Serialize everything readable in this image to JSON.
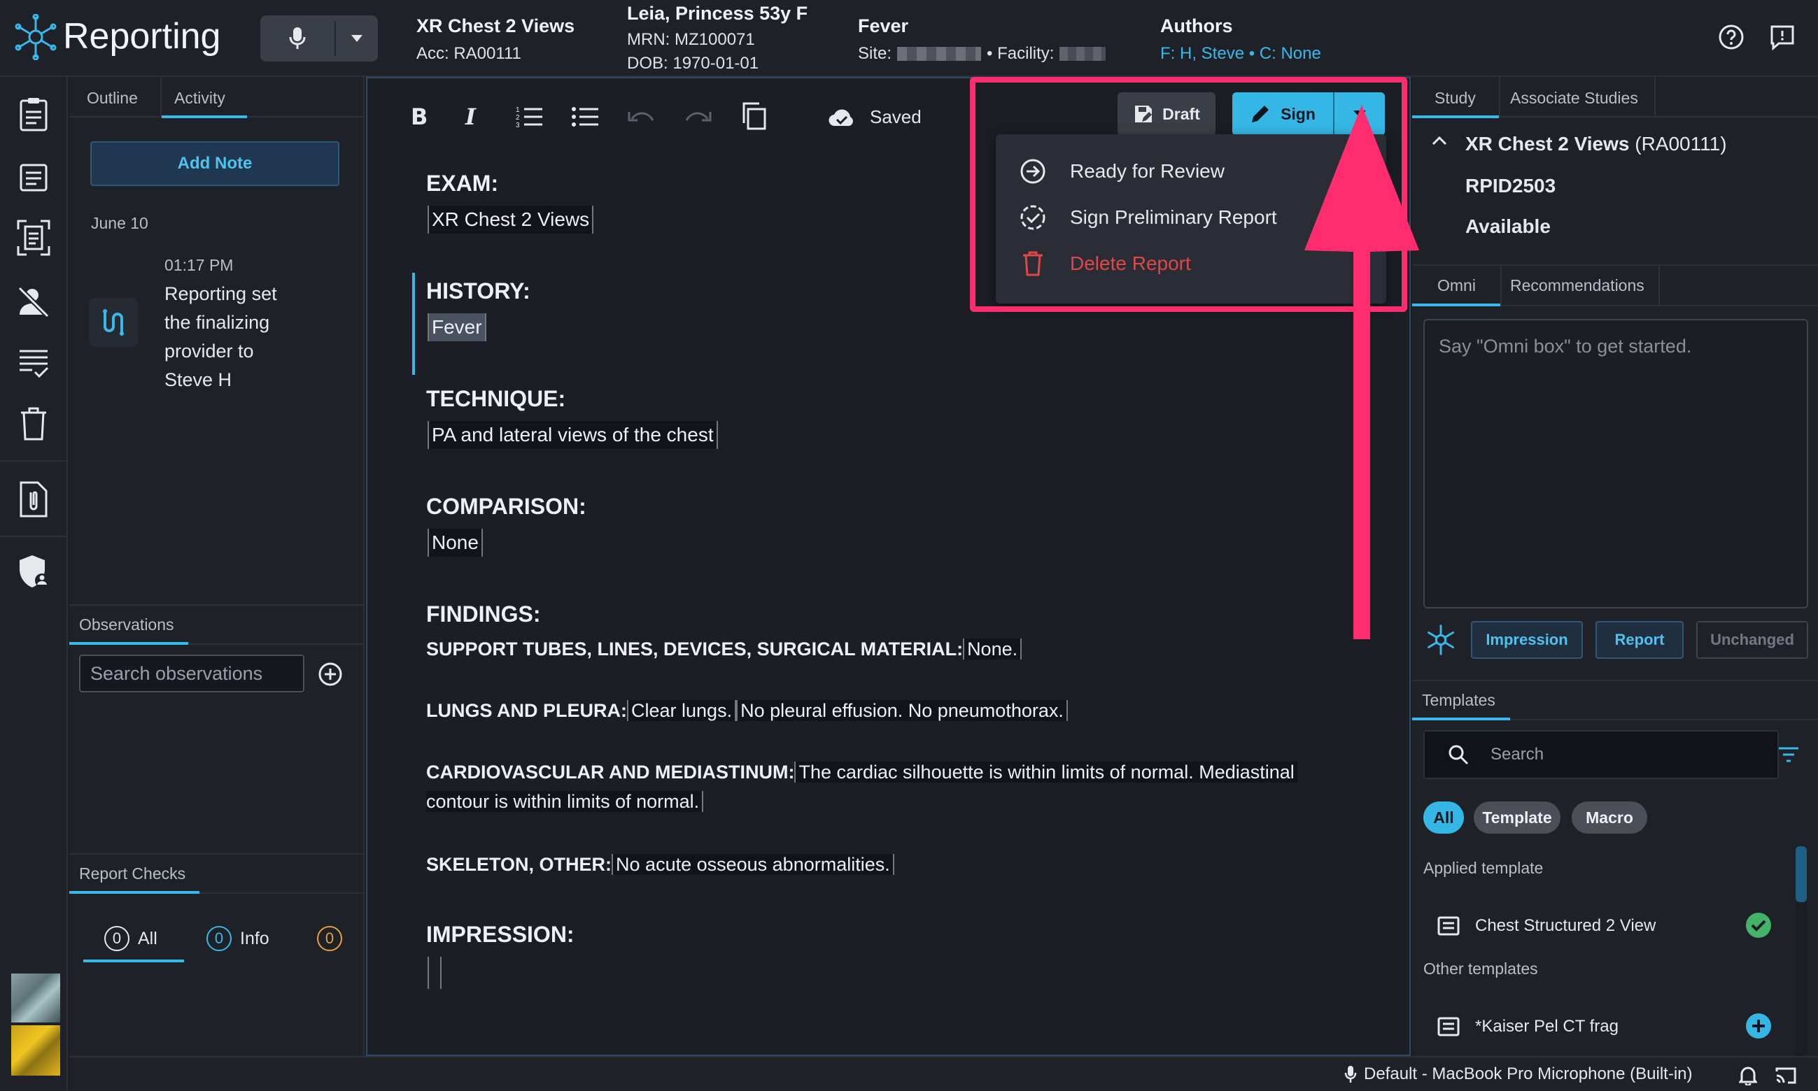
{
  "app": {
    "title": "Reporting"
  },
  "header": {
    "study_title": "XR Chest 2 Views",
    "study_acc": "Acc: RA00111",
    "patient_name": "Leia, Princess 53y F",
    "patient_mrn": "MRN: MZ100071",
    "patient_dob": "DOB: 1970-01-01",
    "reason": "Fever",
    "site_label": "Site:",
    "facility_label": "• Facility:",
    "authors_label": "Authors",
    "authors_value": "F: H, Steve • C: None"
  },
  "notes": {
    "tabs": [
      "Outline",
      "Activity"
    ],
    "add_note": "Add Note",
    "date": "June 10",
    "entry_time": "01:17 PM",
    "entry_lines": [
      "Reporting set",
      "the finalizing",
      "provider to",
      "Steve H"
    ],
    "observations_tab": "Observations",
    "search_placeholder": "Search observations",
    "report_checks_tab": "Report Checks",
    "checks": [
      {
        "count": "0",
        "label": "All"
      },
      {
        "count": "0",
        "label": "Info"
      },
      {
        "count": "0",
        "label": ""
      }
    ]
  },
  "toolbar": {
    "saved": "Saved",
    "draft": "Draft",
    "sign": "Sign"
  },
  "dropdown": {
    "ready": "Ready for Review",
    "prelim": "Sign Preliminary Report",
    "delete": "Delete Report"
  },
  "report": {
    "exam_h": "EXAM:",
    "exam_v": "XR Chest 2 Views",
    "history_h": "HISTORY:",
    "history_v": "Fever",
    "technique_h": "TECHNIQUE:",
    "technique_v": "PA and lateral views of the chest",
    "comparison_h": "COMPARISON:",
    "comparison_v": "None",
    "findings_h": "FINDINGS:",
    "support_l": "SUPPORT TUBES, LINES, DEVICES, SURGICAL MATERIAL:",
    "support_v": "None.",
    "lungs_l": "LUNGS AND PLEURA:",
    "lungs_v1": "Clear lungs.",
    "lungs_v2": "No pleural effusion. No pneumothorax.",
    "cardio_l": "CARDIOVASCULAR AND MEDIASTINUM:",
    "cardio_v1": "The cardiac silhouette is within limits of normal. Mediastinal",
    "cardio_v2": "contour is within limits of normal.",
    "skeleton_l": "SKELETON, OTHER:",
    "skeleton_v": "No acute osseous abnormalities.",
    "impression_h": "IMPRESSION:"
  },
  "right": {
    "tabs": [
      "Study",
      "Associate Studies"
    ],
    "study_title": "XR Chest 2 Views",
    "study_acc": "(RA00111)",
    "rpid": "RPID2503",
    "status": "Available",
    "tabs2": [
      "Omni",
      "Recommendations"
    ],
    "omni_placeholder": "Say \"Omni box\" to get started.",
    "omni_buttons": [
      "Impression",
      "Report",
      "Unchanged"
    ],
    "templates_tab": "Templates",
    "search_placeholder": "Search",
    "filters": [
      "All",
      "Template",
      "Macro"
    ],
    "applied_label": "Applied template",
    "applied_item": "Chest Structured 2 View",
    "other_label": "Other templates",
    "other_item": "*Kaiser Pel CT frag"
  },
  "status": {
    "mic": "Default - MacBook Pro Microphone (Built-in)"
  },
  "colors": {
    "accent": "#38b9e9",
    "annotation": "#ff2d6f",
    "danger": "#e04848",
    "success": "#43b36a",
    "warning": "#e8a13a"
  }
}
